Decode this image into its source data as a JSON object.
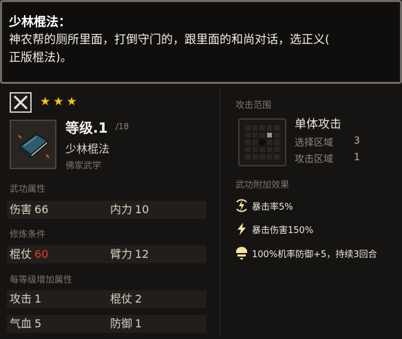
{
  "tooltip": {
    "title": "少林棍法：",
    "line1": "神农帮的厕所里面，打倒守门的，跟里面的和尚对话，选正义(",
    "line2": "正版棍法)。"
  },
  "item": {
    "close_glyph": "✕",
    "stars": [
      "★",
      "★",
      "★"
    ],
    "level": "等级.1",
    "level_max": "/18",
    "name": "少林棍法",
    "type": "佛家武学",
    "icon": "book-icon"
  },
  "sections": {
    "attributes_label": "武功属性",
    "requirements_label": "修炼条件",
    "per_level_label": "每等级增加属性",
    "range_label": "攻击范围",
    "effects_label": "武功附加效果"
  },
  "attributes": [
    {
      "label": "伤害",
      "value": "66"
    },
    {
      "label": "内力",
      "value": "10"
    }
  ],
  "requirements": [
    {
      "label": "棍仗",
      "value": "60",
      "color": "#e53a2e"
    },
    {
      "label": "臂力",
      "value": "12"
    }
  ],
  "per_level": [
    {
      "label": "攻击",
      "value": "1"
    },
    {
      "label": "棍仗",
      "value": "2"
    },
    {
      "label": "气血",
      "value": "5"
    },
    {
      "label": "防御",
      "value": "1"
    }
  ],
  "attack": {
    "title": "单体攻击",
    "select_label": "选择区域",
    "select_value": "3",
    "attack_area_label": "攻击区域",
    "attack_area_value": "1"
  },
  "effects": [
    {
      "icon": "lightning-circle-icon",
      "text": "暴击率5%"
    },
    {
      "icon": "lightning-icon",
      "text": "暴击伤害150%"
    },
    {
      "icon": "shield-buff-icon",
      "text": "100%机率防御+5，持续3回合"
    }
  ],
  "colors": {
    "star": "#f4c21e",
    "requirement_unmet": "#e53a2e",
    "effect_icon": "#f5e3a0"
  }
}
